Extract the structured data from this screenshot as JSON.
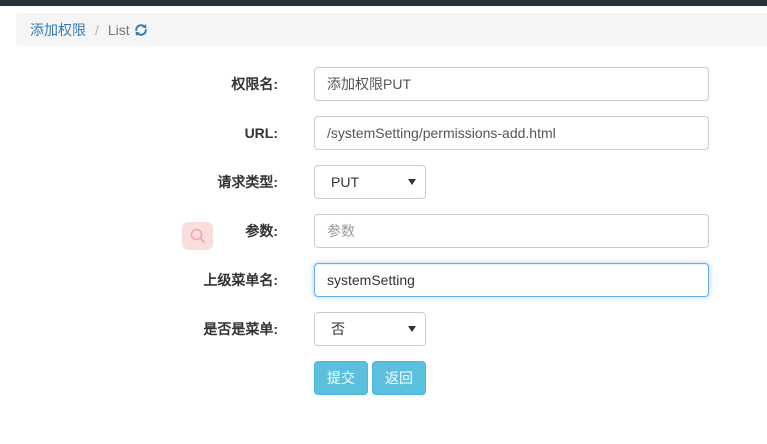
{
  "breadcrumb": {
    "home": "添加权限",
    "separator": "/",
    "current": "List",
    "refresh_icon": "refresh-icon"
  },
  "form": {
    "permission_name": {
      "label": "权限名:",
      "value": "添加权限PUT"
    },
    "url": {
      "label": "URL:",
      "value": "/systemSetting/permissions-add.html"
    },
    "request_type": {
      "label": "请求类型:",
      "selected": "PUT"
    },
    "params": {
      "label": "参数:",
      "placeholder": "参数",
      "value": ""
    },
    "parent_menu": {
      "label": "上级菜单名:",
      "value": "systemSetting"
    },
    "is_menu": {
      "label": "是否是菜单:",
      "selected": "否"
    }
  },
  "buttons": {
    "submit": "提交",
    "back": "返回"
  },
  "colors": {
    "topbar": "#2b3036",
    "link": "#337ab7",
    "button_info": "#5bc0de",
    "focus_border": "#66afe9",
    "search_badge": "#fadddd"
  },
  "icons": {
    "floating_search": "search-icon"
  }
}
